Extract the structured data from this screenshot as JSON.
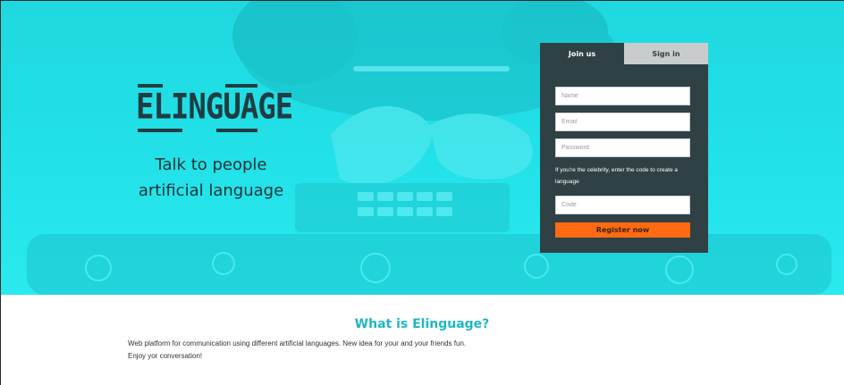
{
  "brand": {
    "logo_text": "ELINGUAGE"
  },
  "hero": {
    "tagline_line1": "Talk to people",
    "tagline_line2": "artificial language"
  },
  "auth": {
    "tabs": [
      {
        "label": "Join us",
        "active": true
      },
      {
        "label": "Sign in",
        "active": false
      }
    ],
    "fields": {
      "name_placeholder": "Name",
      "email_placeholder": "Email",
      "password_placeholder": "Password",
      "code_placeholder": "Code"
    },
    "hint": "If you're the celebrity, enter the code to create a language",
    "register_label": "Register now"
  },
  "about": {
    "title": "What is Elinguage?",
    "description": "Web platform for communication using different artificial languages. New idea for your and your friends fun. Enjoy yor conversation!"
  },
  "colors": {
    "hero_accent": "#22e1e8",
    "panel_bg": "#2f4144",
    "button_orange": "#ff6a13",
    "title_teal": "#1fb8c0"
  }
}
